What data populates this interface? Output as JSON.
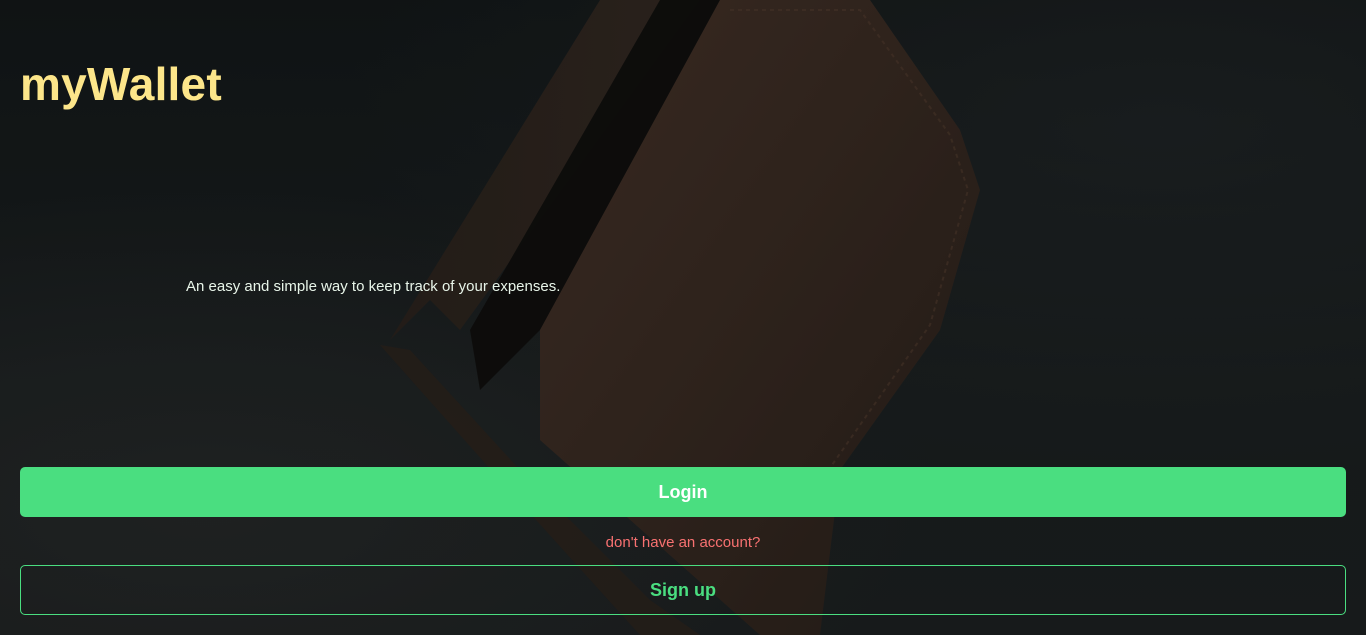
{
  "app": {
    "brand": "myWallet",
    "tagline": "An easy and simple way to keep track of your expenses."
  },
  "actions": {
    "login_label": "Login",
    "no_account_text": "don't have an account?",
    "signup_label": "Sign up"
  },
  "background": {
    "image_subject": "leather-wallet-photo"
  },
  "colors": {
    "brand": "#fde68a",
    "accent": "#4ade80",
    "warning_text": "#f87171",
    "background": "#161a1b"
  }
}
